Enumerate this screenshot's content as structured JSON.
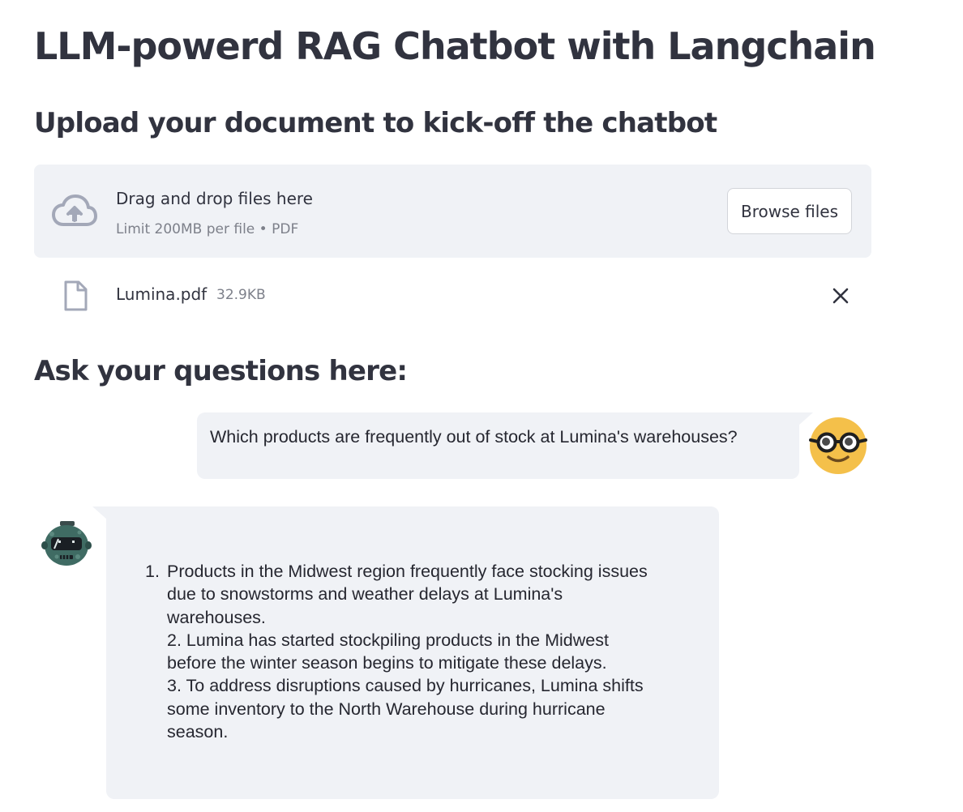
{
  "header": {
    "title": "LLM-powerd RAG Chatbot with Langchain"
  },
  "upload": {
    "heading": "Upload your document to kick-off the chatbot",
    "drop_title": "Drag and drop files here",
    "drop_limit": "Limit 200MB per file • PDF",
    "browse_label": "Browse files",
    "file": {
      "name": "Lumina.pdf",
      "size": "32.9KB"
    }
  },
  "chat": {
    "heading": "Ask your questions here:",
    "user_message": "Which products are frequently out of stock at Lumina's warehouses?",
    "assistant_message": {
      "number": "1.",
      "lines": [
        "Products in the Midwest region frequently face stocking issues",
        "due to snowstorms and weather delays at Lumina's",
        "warehouses.",
        "2. Lumina has started stockpiling products in the Midwest",
        "before the winter season begins to mitigate these delays.",
        "3. To address disruptions caused by hurricanes, Lumina shifts",
        "some inventory to the North Warehouse during hurricane",
        "season."
      ]
    }
  },
  "icons": {
    "upload": "cloud-upload-icon",
    "file": "file-icon",
    "remove": "close-icon",
    "user_avatar": "nerd-face-icon",
    "bot_avatar": "robot-icon"
  },
  "colors": {
    "text": "#31333f",
    "muted": "#7d808a",
    "surface": "#f0f2f6",
    "icon": "#a3a8b8",
    "user_avatar": "#f4c04a"
  }
}
